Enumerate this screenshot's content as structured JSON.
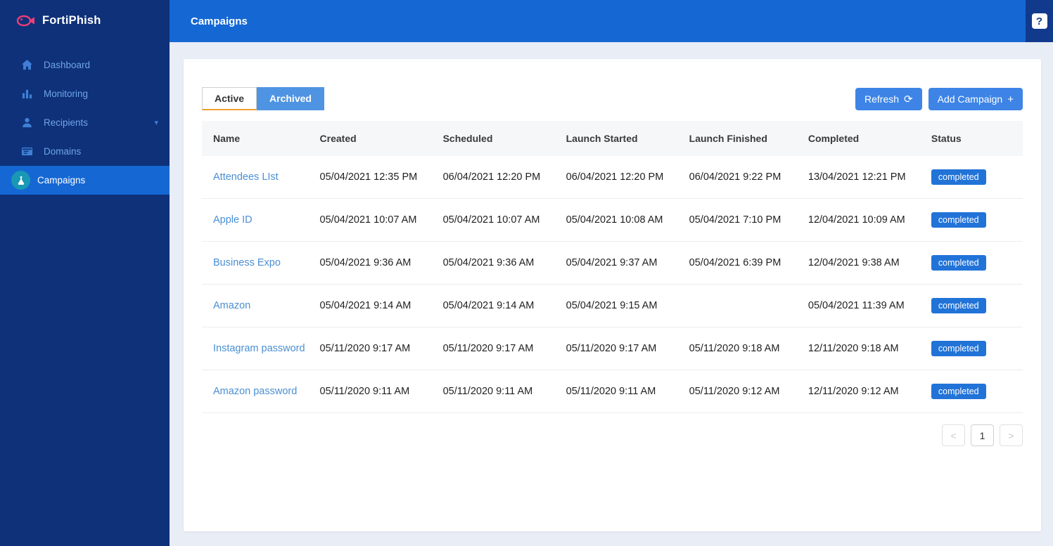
{
  "app": {
    "brand": "FortiPhish",
    "header_title": "Campaigns",
    "help_glyph": "?"
  },
  "colors": {
    "sidebar": "#0e3179",
    "header": "#1568d4",
    "accent_blue": "#3d84e6",
    "badge_blue": "#2173d8",
    "logo_pink": "#ef3e77",
    "active_icon_teal": "#1898b5"
  },
  "sidebar": {
    "items": [
      {
        "label": "Dashboard",
        "icon": "home-icon",
        "active": false
      },
      {
        "label": "Monitoring",
        "icon": "bar-chart-icon",
        "active": false
      },
      {
        "label": "Recipients",
        "icon": "user-icon",
        "active": false,
        "caret": "▾"
      },
      {
        "label": "Domains",
        "icon": "browser-icon",
        "active": false
      },
      {
        "label": "Campaigns",
        "icon": "flask-icon",
        "active": true
      }
    ]
  },
  "tabs": {
    "active_label": "Active",
    "archived_label": "Archived",
    "selected": "Archived"
  },
  "toolbar": {
    "refresh_label": "Refresh",
    "refresh_icon": "⟳",
    "add_campaign_label": "Add Campaign",
    "add_icon": "+"
  },
  "table": {
    "headers": [
      "Name",
      "Created",
      "Scheduled",
      "Launch Started",
      "Launch Finished",
      "Completed",
      "Status"
    ],
    "rows": [
      {
        "name": "Attendees LIst",
        "created": "05/04/2021 12:35 PM",
        "scheduled": "06/04/2021 12:20 PM",
        "launch_started": "06/04/2021 12:20 PM",
        "launch_finished": "06/04/2021 9:22 PM",
        "completed": "13/04/2021 12:21 PM",
        "status": "completed"
      },
      {
        "name": "Apple ID",
        "created": "05/04/2021 10:07 AM",
        "scheduled": "05/04/2021 10:07 AM",
        "launch_started": "05/04/2021 10:08 AM",
        "launch_finished": "05/04/2021 7:10 PM",
        "completed": "12/04/2021 10:09 AM",
        "status": "completed"
      },
      {
        "name": "Business Expo",
        "created": "05/04/2021 9:36 AM",
        "scheduled": "05/04/2021 9:36 AM",
        "launch_started": "05/04/2021 9:37 AM",
        "launch_finished": "05/04/2021 6:39 PM",
        "completed": "12/04/2021 9:38 AM",
        "status": "completed"
      },
      {
        "name": "Amazon",
        "created": "05/04/2021 9:14 AM",
        "scheduled": "05/04/2021 9:14 AM",
        "launch_started": "05/04/2021 9:15 AM",
        "launch_finished": "",
        "completed": "05/04/2021 11:39 AM",
        "status": "completed"
      },
      {
        "name": "Instagram password",
        "created": "05/11/2020 9:17 AM",
        "scheduled": "05/11/2020 9:17 AM",
        "launch_started": "05/11/2020 9:17 AM",
        "launch_finished": "05/11/2020 9:18 AM",
        "completed": "12/11/2020 9:18 AM",
        "status": "completed"
      },
      {
        "name": "Amazon password",
        "created": "05/11/2020 9:11 AM",
        "scheduled": "05/11/2020 9:11 AM",
        "launch_started": "05/11/2020 9:11 AM",
        "launch_finished": "05/11/2020 9:12 AM",
        "completed": "12/11/2020 9:12 AM",
        "status": "completed"
      }
    ]
  },
  "pagination": {
    "prev": "<",
    "current_page": "1",
    "next": ">"
  }
}
